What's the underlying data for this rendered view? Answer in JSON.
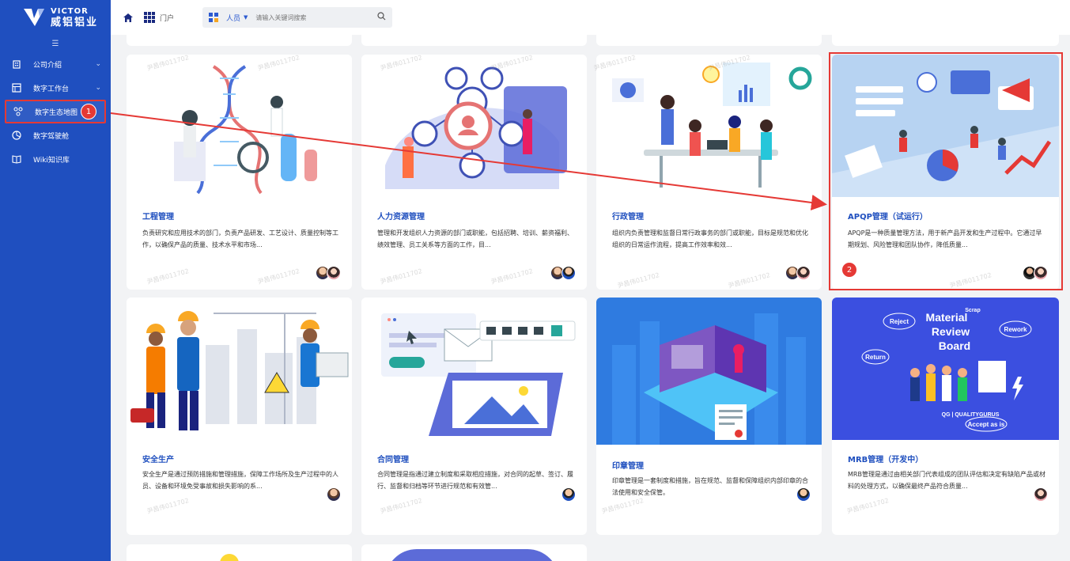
{
  "brand": {
    "name_en": "VICTOR",
    "name_cn": "威铝铝业"
  },
  "sidebar": {
    "collapse_icon": "collapse-icon",
    "items": [
      {
        "label": "公司介绍",
        "icon": "building-icon",
        "has_chevron": true
      },
      {
        "label": "数字工作台",
        "icon": "dashboard-icon",
        "has_chevron": true
      },
      {
        "label": "数字生态地图",
        "icon": "graph-icon",
        "active": true
      },
      {
        "label": "数字驾驶舱",
        "icon": "pie-icon"
      },
      {
        "label": "Wiki知识库",
        "icon": "book-icon"
      }
    ]
  },
  "header": {
    "portal_label": "门户",
    "search": {
      "category": "人员",
      "placeholder": "请输入关键词搜索"
    }
  },
  "annotations": {
    "badge_1": "1",
    "badge_2": "2",
    "highlight_color": "#e53935"
  },
  "watermark": "尹昌伟011702",
  "cards": [
    {
      "title": "工程管理",
      "desc": "负责研究和应用技术的部门，负责产品研发、工艺设计、质量控制等工作，以确保产品的质量、技术水平和市场..."
    },
    {
      "title": "人力资源管理",
      "desc": "管理和开发组织人力资源的部门或职能，包括招聘、培训、薪资福利、绩效管理、员工关系等方面的工作，目..."
    },
    {
      "title": "行政管理",
      "desc": "组织内负责管理和监督日常行政事务的部门或职能，目标是规范和优化组织的日常运作流程，提高工作效率和效..."
    },
    {
      "title": "APQP管理（试运行）",
      "desc": "APQP是一种质量管理方法，用于新产品开发和生产过程中。它通过早期规划、风险管理和团队协作，降低质量..."
    },
    {
      "title": "安全生产",
      "desc": "安全生产是通过预防措施和管理措施，保障工作场所及生产过程中的人员、设备和环境免受事故和损失影响的系..."
    },
    {
      "title": "合同管理",
      "desc": "合同管理是指通过建立制度和采取相应措施，对合同的起草、签订、履行、监督和归档等环节进行规范和有效管..."
    },
    {
      "title": "印章管理",
      "desc": "印章管理是一套制度和措施，旨在规范、监督和保障组织内部印章的合法使用和安全保管。"
    },
    {
      "title": "MRB管理（开发中）",
      "desc": "MRB管理是通过由相关部门代表组成的团队评估和决定有缺陷产品或材料的处理方式，以确保最终产品符合质量..."
    }
  ],
  "mrb_image_text": {
    "board": "Material Review Board",
    "tags": [
      "Reject",
      "Rework",
      "Return",
      "Accept as is",
      "Scrap"
    ],
    "brand": "QUALITYGURUS"
  },
  "colors": {
    "sidebar": "#1f4fbf",
    "accent": "#1f4fbf",
    "background": "#f2f3f5"
  }
}
